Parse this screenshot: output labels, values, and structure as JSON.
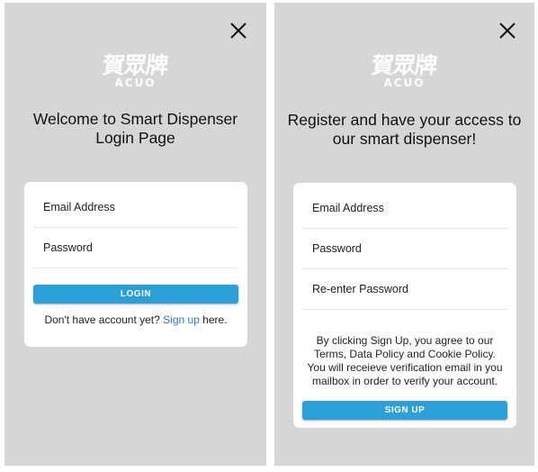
{
  "login": {
    "logo_cn": "賀眾牌",
    "logo_en": "ACUO",
    "heading_line1": "Welcome to Smart Dispenser",
    "heading_line2": "Login Page",
    "email_placeholder": "Email Address",
    "password_placeholder": "Password",
    "button_label": "LOGIN",
    "footer_prefix": "Don't have account yet?",
    "footer_link": "Sign up",
    "footer_suffix": "here."
  },
  "register": {
    "logo_cn": "賀眾牌",
    "logo_en": "ACUO",
    "heading_line1": "Register and have your access to",
    "heading_line2": "our smart dispenser!",
    "email_placeholder": "Email Address",
    "password_placeholder": "Password",
    "reenter_placeholder": "Re-enter Password",
    "terms_line1": "By clicking Sign Up, you agree to our",
    "terms_line2": "Terms, Data Policy and Cookie Policy.",
    "terms_line3": "You will receieve verification email in you",
    "terms_line4": "mailbox in order to verify your account.",
    "button_label": "SIGN UP"
  },
  "icons": {
    "close": "close-icon"
  },
  "colors": {
    "panel_bg": "#d6d6d6",
    "accent": "#2b9fd8",
    "link": "#2a78c8"
  }
}
